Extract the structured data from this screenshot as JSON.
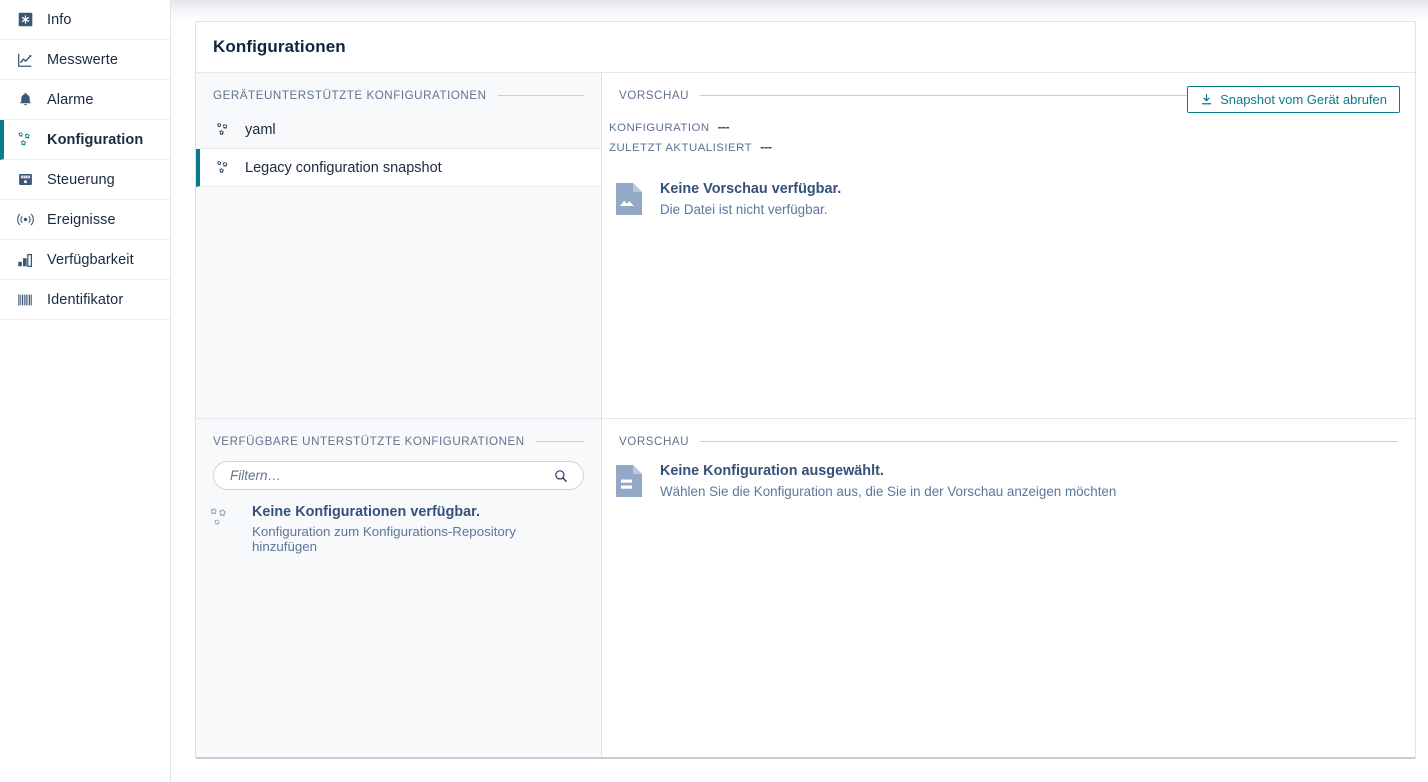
{
  "sidebar": {
    "items": [
      {
        "label": "Info",
        "icon": "asterisk-box-icon",
        "active": false
      },
      {
        "label": "Messwerte",
        "icon": "line-chart-icon",
        "active": false
      },
      {
        "label": "Alarme",
        "icon": "bell-icon",
        "active": false
      },
      {
        "label": "Konfiguration",
        "icon": "gears-icon",
        "active": true
      },
      {
        "label": "Steuerung",
        "icon": "gauge-icon",
        "active": false
      },
      {
        "label": "Ereignisse",
        "icon": "broadcast-icon",
        "active": false
      },
      {
        "label": "Verfügbarkeit",
        "icon": "bar-chart-icon",
        "active": false
      },
      {
        "label": "Identifikator",
        "icon": "barcode-icon",
        "active": false
      }
    ]
  },
  "card": {
    "title": "Konfigurationen"
  },
  "device_supported": {
    "section_label": "GERÄTEUNTERSTÜTZTE KONFIGURATIONEN",
    "items": [
      {
        "label": "yaml",
        "icon": "gears-icon",
        "selected": false
      },
      {
        "label": "Legacy configuration snapshot",
        "icon": "gears-icon",
        "selected": true
      }
    ]
  },
  "available_supported": {
    "section_label": "VERFÜGBARE UNTERSTÜTZTE KONFIGURATIONEN",
    "filter": {
      "placeholder": "Filtern…",
      "value": "",
      "icon": "search-icon"
    },
    "empty": {
      "icon": "gears-icon",
      "title": "Keine Konfigurationen verfügbar.",
      "subtitle": "Konfiguration zum Konfigurations-Repository hinzufügen"
    }
  },
  "preview_top": {
    "section_label": "VORSCHAU",
    "meta": [
      {
        "key": "KONFIGURATION",
        "value": "---"
      },
      {
        "key": "ZULETZT AKTUALISIERT",
        "value": "---"
      }
    ],
    "snapshot_button": {
      "label": "Snapshot vom Gerät abrufen",
      "icon": "download-icon"
    },
    "empty": {
      "icon": "file-image-icon",
      "title": "Keine Vorschau verfügbar.",
      "subtitle": "Die Datei ist nicht verfügbar."
    }
  },
  "preview_bottom": {
    "section_label": "VORSCHAU",
    "empty": {
      "icon": "file-text-icon",
      "title": "Keine Konfiguration ausgewählt.",
      "subtitle": "Wählen Sie die Konfiguration aus, die Sie in der Vorschau anzeigen möchten"
    }
  },
  "colors": {
    "accent": "#0b7b8a",
    "text_dark": "#0f2540",
    "muted": "#62738c",
    "empty_icon": "#93a8c4"
  }
}
